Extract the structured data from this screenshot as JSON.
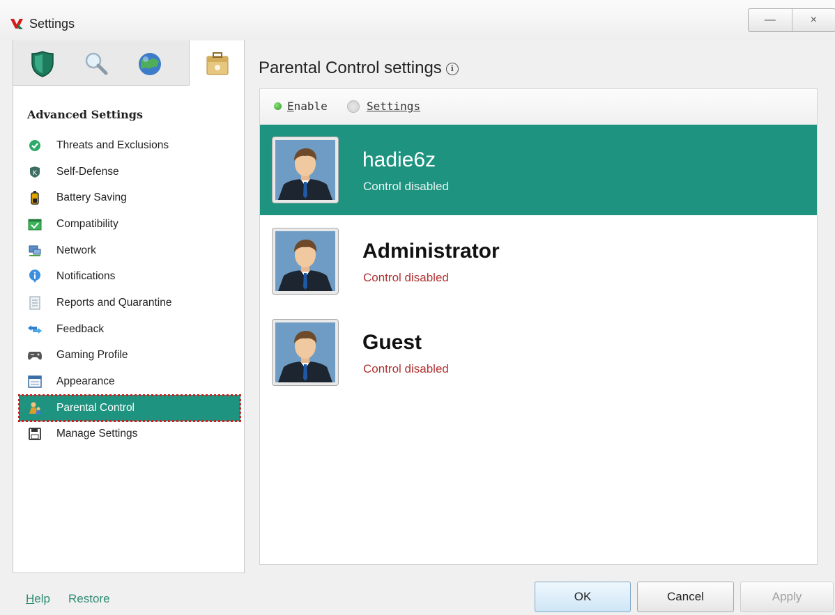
{
  "window": {
    "title": "Settings",
    "minimize_label": "—",
    "close_label": "×"
  },
  "sidebar": {
    "tabs": [
      {
        "name": "protection",
        "icon": "shield-icon"
      },
      {
        "name": "scan",
        "icon": "magnifier-icon"
      },
      {
        "name": "update",
        "icon": "globe-icon"
      },
      {
        "name": "advanced",
        "icon": "toolbox-icon"
      }
    ],
    "section_title": "Advanced Settings",
    "items": [
      {
        "label": "Threats and Exclusions",
        "icon": "green-check-icon"
      },
      {
        "label": "Self-Defense",
        "icon": "k-shield-icon"
      },
      {
        "label": "Battery Saving",
        "icon": "battery-icon"
      },
      {
        "label": "Compatibility",
        "icon": "compatibility-check-icon"
      },
      {
        "label": "Network",
        "icon": "network-icon"
      },
      {
        "label": "Notifications",
        "icon": "info-bubble-icon"
      },
      {
        "label": "Reports and Quarantine",
        "icon": "report-icon"
      },
      {
        "label": "Feedback",
        "icon": "arrows-icon"
      },
      {
        "label": "Gaming Profile",
        "icon": "gamepad-icon"
      },
      {
        "label": "Appearance",
        "icon": "window-icon"
      },
      {
        "label": "Parental Control",
        "icon": "parental-icon",
        "active": true
      },
      {
        "label": "Manage Settings",
        "icon": "floppy-icon"
      }
    ]
  },
  "main": {
    "title": "Parental Control settings",
    "toolbar": {
      "enable_first": "E",
      "enable_rest": "nable",
      "settings_first": "S",
      "settings_rest": "ettings"
    },
    "users": [
      {
        "name": "hadie6z",
        "status": "Control disabled",
        "selected": true
      },
      {
        "name": "Administrator",
        "status": "Control disabled"
      },
      {
        "name": "Guest",
        "status": "Control disabled"
      }
    ]
  },
  "footer": {
    "help_first": "H",
    "help_rest": "elp",
    "restore_label": "Restore",
    "ok_label": "OK",
    "cancel_label": "Cancel",
    "apply_label": "Apply"
  },
  "colors": {
    "accent": "#1e9480",
    "status_red": "#b03030",
    "highlight_outline": "#d21f1f"
  }
}
